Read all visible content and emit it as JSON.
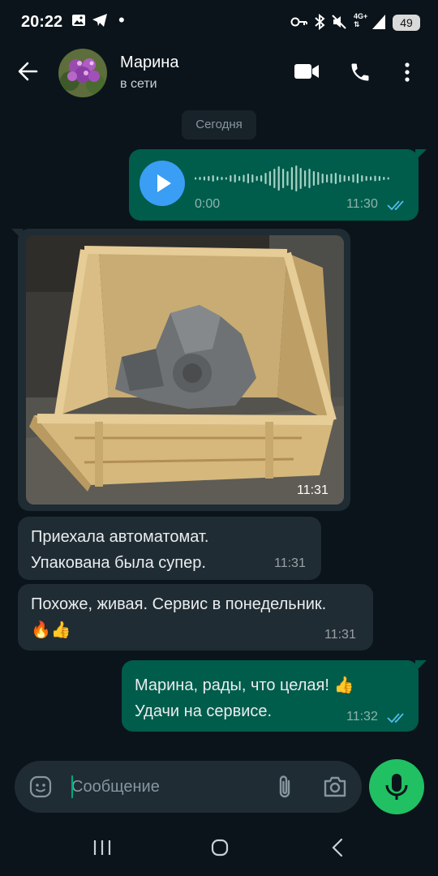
{
  "status_bar": {
    "time": "20:22",
    "battery": "49",
    "network": "4G+"
  },
  "header": {
    "contact_name": "Марина",
    "contact_status": "в сети"
  },
  "date_chip": "Сегодня",
  "messages": [
    {
      "type": "voice",
      "direction": "outgoing",
      "duration": "0:00",
      "time": "11:30",
      "read": true
    },
    {
      "type": "image",
      "direction": "incoming",
      "time": "11:31"
    },
    {
      "type": "text",
      "direction": "incoming",
      "text": "Приехала автоматомат.\nУпакована была супер.",
      "time": "11:31"
    },
    {
      "type": "text",
      "direction": "incoming",
      "text": "Похоже, живая. Сервис в понедельник.\n🔥👍",
      "time": "11:31"
    },
    {
      "type": "text",
      "direction": "outgoing",
      "text": "Марина, рады, что целая! 👍\nУдачи на сервисе.",
      "time": "11:32",
      "read": true
    }
  ],
  "composer": {
    "placeholder": "Сообщение"
  },
  "colors": {
    "background": "#0b141a",
    "outgoing_bubble": "#005c4b",
    "incoming_bubble": "#202c33",
    "accent_green": "#21c063",
    "read_ticks": "#53bdeb",
    "play_button": "#3a9ef4"
  },
  "icons": [
    "back-arrow-icon",
    "video-call-icon",
    "phone-icon",
    "more-vert-icon",
    "play-icon",
    "double-check-icon",
    "emoji-icon",
    "attach-icon",
    "camera-icon",
    "mic-icon"
  ]
}
